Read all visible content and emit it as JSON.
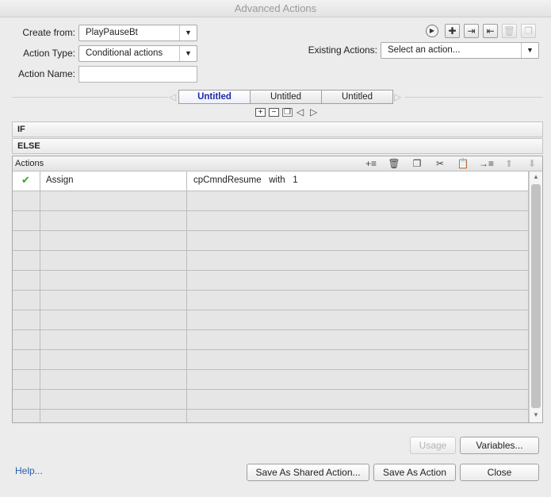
{
  "window": {
    "title": "Advanced Actions"
  },
  "form": {
    "create_from_label": "Create from:",
    "create_from_value": "PlayPauseBt",
    "action_type_label": "Action Type:",
    "action_type_value": "Conditional actions",
    "action_name_label": "Action Name:",
    "action_name_value": "",
    "existing_actions_label": "Existing Actions:",
    "existing_actions_value": "Select an action..."
  },
  "toolbar": {
    "icons": [
      "play-icon",
      "add-icon",
      "import-icon",
      "export-icon",
      "delete-icon",
      "duplicate-icon"
    ]
  },
  "tabs": [
    {
      "label": "Untitled",
      "active": true
    },
    {
      "label": "Untitled",
      "active": false
    },
    {
      "label": "Untitled",
      "active": false
    }
  ],
  "sections": {
    "if_label": "IF",
    "else_label": "ELSE",
    "actions_label": "Actions"
  },
  "actions_rows": [
    {
      "check": "✔",
      "command": "Assign",
      "detail": "cpCmndResume   with   1"
    }
  ],
  "buttons": {
    "usage": "Usage",
    "variables": "Variables...",
    "save_shared": "Save As Shared Action...",
    "save_action": "Save As Action",
    "close": "Close"
  },
  "help": "Help...",
  "colors": {
    "accent_tab": "#1b2aa8",
    "check": "#3aa02e",
    "link": "#2a5db0"
  }
}
